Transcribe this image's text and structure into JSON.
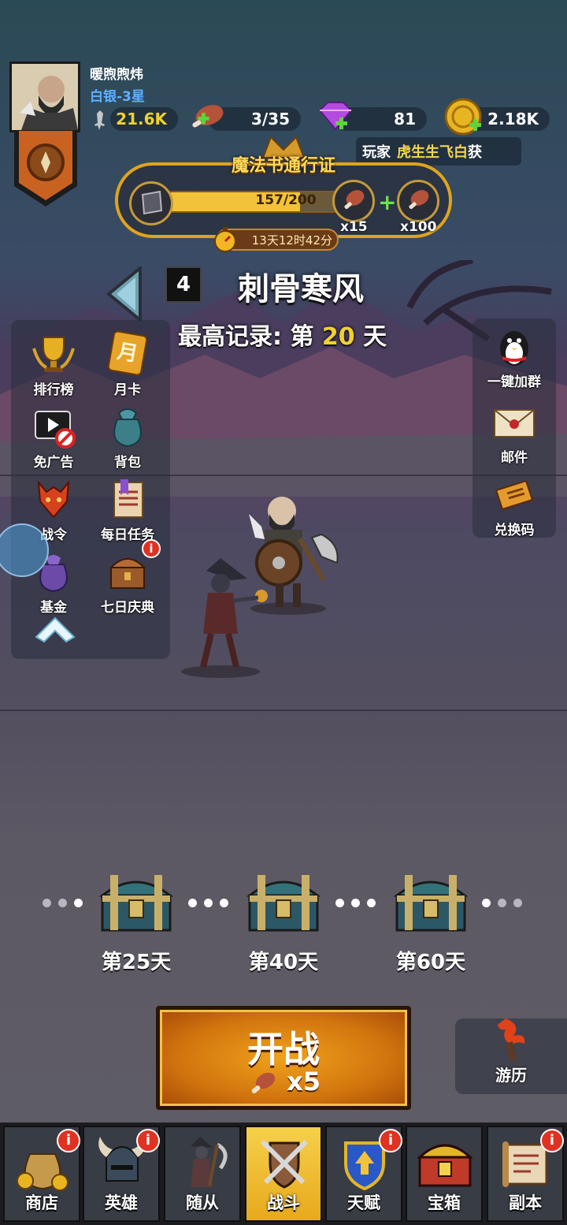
{
  "player": {
    "name": "暖煦煦炜",
    "rank": "白银-3星"
  },
  "resources": {
    "power": "21.6K",
    "stamina": "3/35",
    "gems": "81",
    "gold": "2.18K"
  },
  "ticker": {
    "prefix": "玩家",
    "player_name": "虎生生飞白",
    "suffix": "获"
  },
  "battle_pass": {
    "title": "魔法书通行证",
    "progress": "157/200",
    "progress_fraction": 0.785,
    "reward1_count": "x15",
    "reward2_count": "x100",
    "timer": "13天12时42分"
  },
  "stage": {
    "number": "4",
    "name": "刺骨寒风",
    "best_prefix": "最高记录: 第",
    "best_day": "20",
    "best_suffix": "天"
  },
  "left_menu": [
    {
      "label": "排行榜",
      "icon": "trophy-icon"
    },
    {
      "label": "月卡",
      "icon": "month-card-icon",
      "icon_text": "月"
    },
    {
      "label": "免广告",
      "icon": "no-ads-icon"
    },
    {
      "label": "背包",
      "icon": "bag-icon"
    },
    {
      "label": "战令",
      "icon": "war-order-icon"
    },
    {
      "label": "每日任务",
      "icon": "daily-task-icon"
    },
    {
      "label": "基金",
      "icon": "fund-icon"
    },
    {
      "label": "七日庆典",
      "icon": "seven-day-chest-icon",
      "badge": "i"
    }
  ],
  "right_menu": [
    {
      "label": "一键加群",
      "icon": "qq-penguin-icon"
    },
    {
      "label": "邮件",
      "icon": "mail-icon"
    },
    {
      "label": "兑换码",
      "icon": "redeem-ticket-icon"
    }
  ],
  "chests": [
    {
      "label": "第25天"
    },
    {
      "label": "第40天"
    },
    {
      "label": "第60天"
    }
  ],
  "start": {
    "label": "开战",
    "cost": "x5"
  },
  "travel": {
    "label": "游历"
  },
  "nav": {
    "tabs": [
      {
        "label": "商店",
        "badge": "i",
        "active": false
      },
      {
        "label": "英雄",
        "badge": "i",
        "active": false
      },
      {
        "label": "随从",
        "badge": "",
        "active": false
      },
      {
        "label": "战斗",
        "badge": "",
        "active": true
      },
      {
        "label": "天赋",
        "badge": "i",
        "active": false
      },
      {
        "label": "宝箱",
        "badge": "",
        "active": false
      },
      {
        "label": "副本",
        "badge": "i",
        "active": false
      }
    ]
  },
  "colors": {
    "gold_text": "#f0d12e",
    "rank_blue": "#5fb0ff",
    "accent_orange": "#e7a91d",
    "badge_red": "#e03222"
  }
}
